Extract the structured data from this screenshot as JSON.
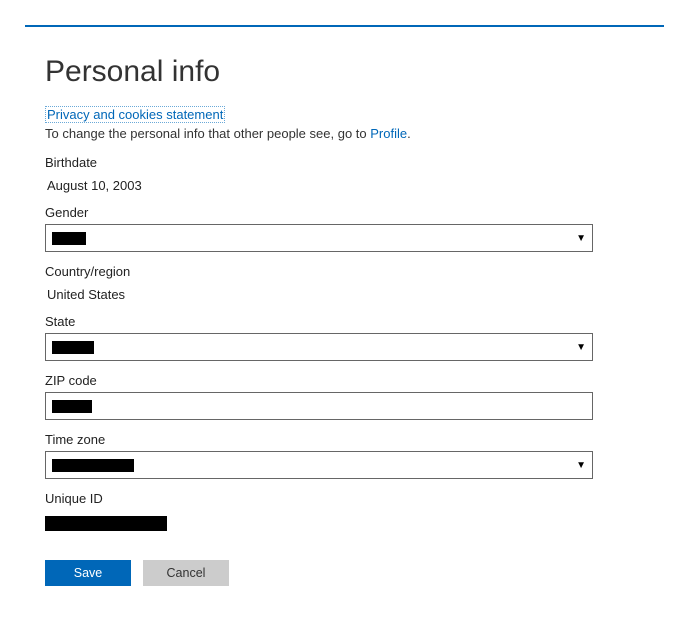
{
  "title": "Personal info",
  "links": {
    "privacy": "Privacy and cookies statement",
    "desc_prefix": "To change the personal info that other people see, go to ",
    "profile": "Profile",
    "desc_suffix": "."
  },
  "fields": {
    "birthdate_label": "Birthdate",
    "birthdate_value": "August 10, 2003",
    "gender_label": "Gender",
    "gender_value": "",
    "country_label": "Country/region",
    "country_value": "United States",
    "state_label": "State",
    "state_value": "",
    "zip_label": "ZIP code",
    "zip_value": "",
    "timezone_label": "Time zone",
    "timezone_value": "",
    "uniqueid_label": "Unique ID",
    "uniqueid_value": ""
  },
  "buttons": {
    "save": "Save",
    "cancel": "Cancel"
  }
}
